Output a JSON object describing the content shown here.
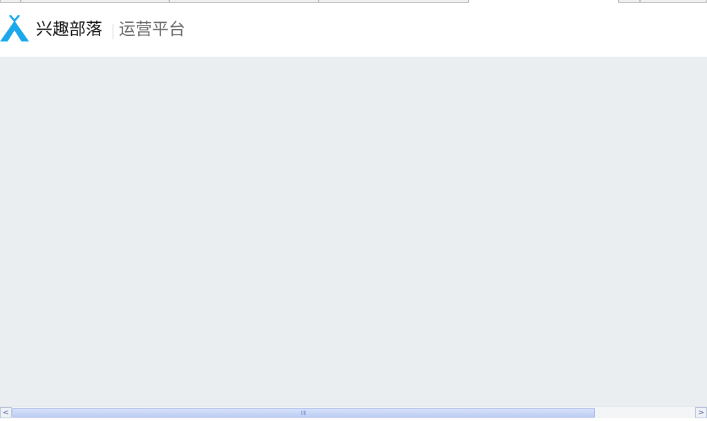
{
  "header": {
    "brand_name": "兴趣部落",
    "platform_name": "运营平台"
  },
  "colors": {
    "brand_blue": "#1aa7ec",
    "content_bg": "#eaeef0",
    "scroll_thumb": "#bccdf4"
  },
  "icons": {
    "logo": "tent-logo-icon",
    "scroll_left": "scroll-left-arrow-icon",
    "scroll_right": "scroll-right-arrow-icon"
  },
  "scrollbar": {
    "left_arrow": "<",
    "right_arrow": ">"
  }
}
